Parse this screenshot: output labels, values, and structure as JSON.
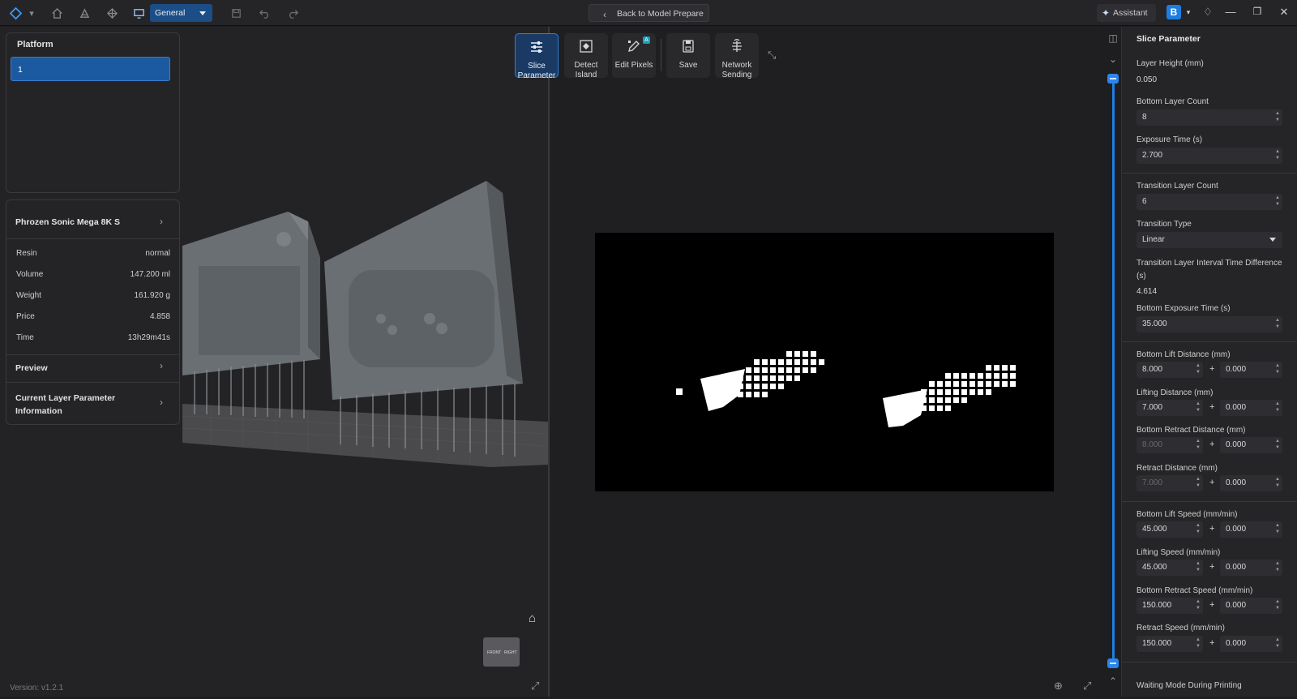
{
  "topbar": {
    "profile_select": "General",
    "back_button": "Back to Model Prepare",
    "assistant_button": "Assistant",
    "brand_badge": "B"
  },
  "platform_panel": {
    "title": "Platform",
    "items": [
      "1"
    ]
  },
  "printer_panel": {
    "printer_name": "Phrozen Sonic Mega 8K S",
    "rows": [
      {
        "label": "Resin",
        "value": "normal"
      },
      {
        "label": "Volume",
        "value": "147.200 ml"
      },
      {
        "label": "Weight",
        "value": "161.920 g"
      },
      {
        "label": "Price",
        "value": "4.858"
      },
      {
        "label": "Time",
        "value": "13h29m41s"
      }
    ],
    "preview_label": "Preview",
    "layer_info_label_line1": "Current Layer Parameter",
    "layer_info_label_line2": "Information"
  },
  "toolbar": {
    "slice_parameter_line1": "Slice",
    "slice_parameter_line2": "Parameter",
    "detect_island_line1": "Detect",
    "detect_island_line2": "Island",
    "edit_pixels": "Edit Pixels",
    "edit_pixels_badge": "A",
    "save": "Save",
    "network_sending_line1": "Network",
    "network_sending_line2": "Sending"
  },
  "slice_param": {
    "title": "Slice Parameter",
    "layer_height_label": "Layer Height (mm)",
    "layer_height_value": "0.050",
    "bottom_layer_count_label": "Bottom Layer Count",
    "bottom_layer_count_value": "8",
    "exposure_time_label": "Exposure Time (s)",
    "exposure_time_value": "2.700",
    "transition_layer_count_label": "Transition Layer Count",
    "transition_layer_count_value": "6",
    "transition_type_label": "Transition Type",
    "transition_type_value": "Linear",
    "transition_interval_label": "Transition Layer Interval Time Difference (s)",
    "transition_interval_value": "4.614",
    "bottom_exposure_label": "Bottom Exposure Time (s)",
    "bottom_exposure_value": "35.000",
    "bottom_lift_distance_label": "Bottom Lift Distance (mm)",
    "bottom_lift_distance_a": "8.000",
    "bottom_lift_distance_b": "0.000",
    "lifting_distance_label": "Lifting Distance (mm)",
    "lifting_distance_a": "7.000",
    "lifting_distance_b": "0.000",
    "bottom_retract_distance_label": "Bottom Retract Distance (mm)",
    "bottom_retract_distance_a": "8.000",
    "bottom_retract_distance_b": "0.000",
    "retract_distance_label": "Retract Distance  (mm)",
    "retract_distance_a": "7.000",
    "retract_distance_b": "0.000",
    "bottom_lift_speed_label": "Bottom Lift Speed  (mm/min)",
    "bottom_lift_speed_a": "45.000",
    "bottom_lift_speed_b": "0.000",
    "lifting_speed_label": "Lifting Speed  (mm/min)",
    "lifting_speed_a": "45.000",
    "lifting_speed_b": "0.000",
    "bottom_retract_speed_label": "Bottom Retract Speed  (mm/min)",
    "bottom_retract_speed_a": "150.000",
    "bottom_retract_speed_b": "0.000",
    "retract_speed_label": "Retract Speed  (mm/min)",
    "retract_speed_a": "150.000",
    "retract_speed_b": "0.000",
    "waiting_mode_label": "Waiting Mode During Printing",
    "plus": "+"
  },
  "viewcube": {
    "front": "FRONT",
    "right": "RIGHT"
  },
  "footer": {
    "version": "Version: v1.2.1"
  },
  "colors": {
    "accent": "#1e7de0",
    "background": "#1e1e20",
    "panel": "#242427"
  }
}
